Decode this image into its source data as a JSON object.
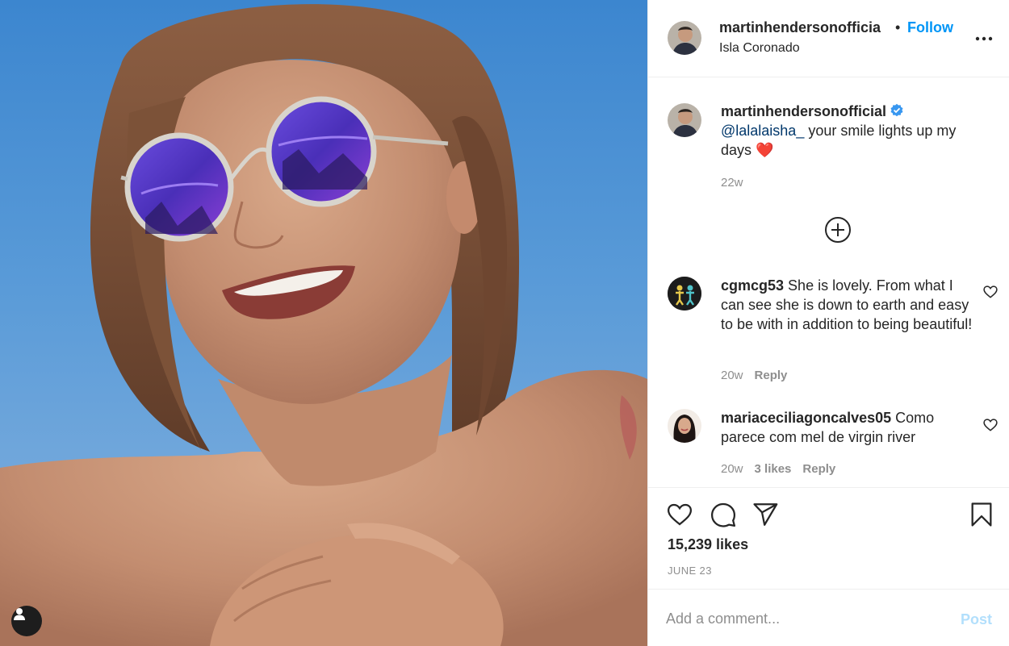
{
  "post": {
    "username": "martinhendersonofficia",
    "separator": "•",
    "follow_label": "Follow",
    "location": "Isla Coronado",
    "more_icon": "more-horizontal-icon"
  },
  "caption": {
    "username": "martinhendersonofficial",
    "verified": true,
    "mention": "@lalalaisha_",
    "text": " your smile lights up my days ",
    "emoji": "❤️",
    "time": "22w"
  },
  "comments": [
    {
      "username": "cgmcg53",
      "text": " She is lovely. From what I can see she is down to earth and easy to be with in addition to being beautiful!",
      "time": "20w",
      "likes": "",
      "reply_label": "Reply"
    },
    {
      "username": "mariaceciliagoncalves05",
      "text": " Como parece com mel de virgin river",
      "time": "20w",
      "likes": "3 likes",
      "reply_label": "Reply"
    }
  ],
  "actions": {
    "likes": "15,239 likes",
    "date": "JUNE 23"
  },
  "comment_box": {
    "placeholder": "Add a comment...",
    "post_label": "Post"
  },
  "colors": {
    "link_blue": "#0095f6",
    "post_disabled": "#b2dffc",
    "muted_text": "#8e8e8e",
    "mention": "#00376b"
  }
}
